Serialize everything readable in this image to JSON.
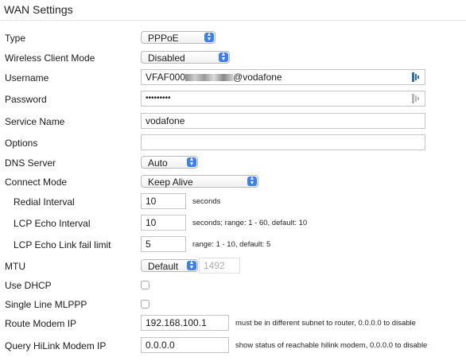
{
  "title": "WAN Settings",
  "rows": {
    "type": {
      "label": "Type",
      "value": "PPPoE"
    },
    "wireless_client_mode": {
      "label": "Wireless Client Mode",
      "value": "Disabled"
    },
    "username": {
      "label": "Username",
      "prefix": "VFAF000",
      "suffix": "@vodafone"
    },
    "password": {
      "label": "Password",
      "value": "•••••••••"
    },
    "service_name": {
      "label": "Service Name",
      "value": "vodafone"
    },
    "options": {
      "label": "Options",
      "value": ""
    },
    "dns_server": {
      "label": "DNS Server",
      "value": "Auto"
    },
    "connect_mode": {
      "label": "Connect Mode",
      "value": "Keep Alive"
    },
    "redial_interval": {
      "label": "Redial Interval",
      "value": "10",
      "hint": "seconds"
    },
    "lcp_echo_interval": {
      "label": "LCP Echo Interval",
      "value": "10",
      "hint": "seconds; range: 1 - 60, default: 10"
    },
    "lcp_echo_fail_limit": {
      "label": "LCP Echo Link fail limit",
      "value": "5",
      "hint": "range: 1 - 10, default: 5"
    },
    "mtu": {
      "label": "MTU",
      "value": "Default",
      "input_value": "1492"
    },
    "use_dhcp": {
      "label": "Use DHCP",
      "checked": false
    },
    "single_line_mlppp": {
      "label": "Single Line MLPPP",
      "checked": false
    },
    "route_modem_ip": {
      "label": "Route Modem IP",
      "value": "192.168.100.1",
      "hint": "must be in different subnet to router, 0.0.0.0 to disable"
    },
    "query_hilink_modem_ip": {
      "label": "Query HiLink Modem IP",
      "value": "0.0.0.0",
      "hint": "show status of reachable hilink modem, 0.0.0.0 to disable"
    }
  },
  "colors": {
    "accent": "#3a7ff6",
    "border": "#c4c4c4"
  },
  "icons": {
    "select_arrow": "up-down-chevron-icon",
    "password_manager": "key-icon"
  }
}
